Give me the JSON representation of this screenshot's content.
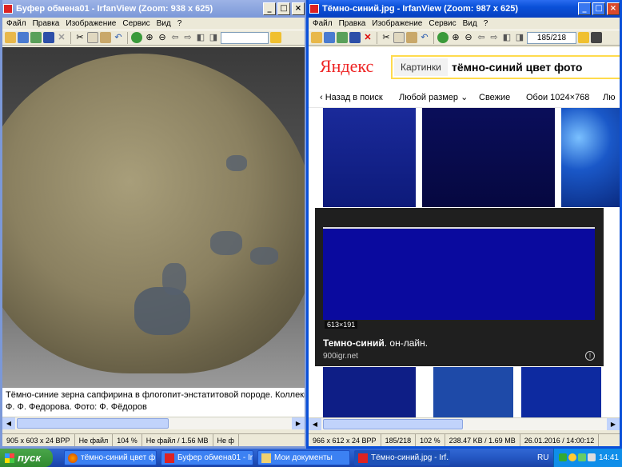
{
  "left_window": {
    "title": "Буфер обмена01 - IrfanView (Zoom: 938 x 625)",
    "menu": [
      "Файл",
      "Правка",
      "Изображение",
      "Сервис",
      "Вид",
      "?"
    ],
    "caption_lines": [
      "Тёмно-синие зерна сапфирина в флогопит-энстатитовой породе. Коллекц",
      "Ф. Ф. Федорова. Фото: Ф. Фёдоров"
    ],
    "status": [
      "905 x 603 x 24 BPP",
      "Не файл",
      "104 %",
      "Не файл / 1.56 MB",
      "Не ф"
    ]
  },
  "right_window": {
    "title": "Тёмно-синий.jpg - IrfanView (Zoom: 987 x 625)",
    "menu": [
      "Файл",
      "Правка",
      "Изображение",
      "Сервис",
      "Вид",
      "?"
    ],
    "counter": "185/218",
    "status": [
      "966 x 612 x 24 BPP",
      "185/218",
      "102 %",
      "238.47 KB / 1.69 MB",
      "26.01.2016 / 14:00:12"
    ]
  },
  "yandex": {
    "logo": "Яндекс",
    "tab": "Картинки",
    "query": "тёмно-синий цвет фото",
    "filters": [
      "‹ Назад в поиск",
      "Любой размер",
      "Свежие",
      "Обои 1024×768",
      "Лю"
    ],
    "preview": {
      "size": "613×191",
      "title_bold": "Темно-синий",
      "title_rest": ". он-лайн.",
      "source": "900igr.net",
      "color": "#0a0a9e"
    }
  },
  "taskbar": {
    "start": "пуск",
    "tasks": [
      "тёмно-синий цвет ф...",
      "Буфер обмена01 - Irf...",
      "Мои документы",
      "Тёмно-синий.jpg - Irf..."
    ],
    "lang": "RU",
    "clock": "14:41"
  },
  "colors": {
    "title_active": "#0a50d8",
    "title_inactive": "#7b98d8",
    "win_face": "#ece9d8"
  }
}
